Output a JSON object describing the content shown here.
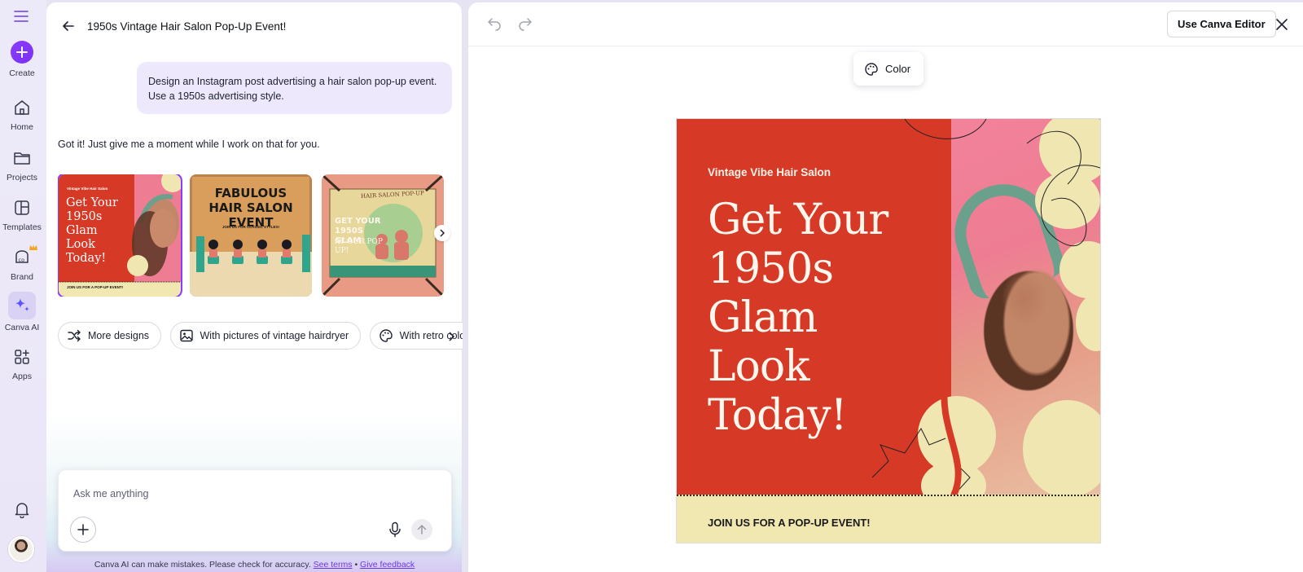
{
  "rail": {
    "items": [
      {
        "label": "Create",
        "icon": "plus-icon"
      },
      {
        "label": "Home",
        "icon": "home-icon"
      },
      {
        "label": "Projects",
        "icon": "folder-icon"
      },
      {
        "label": "Templates",
        "icon": "templates-icon"
      },
      {
        "label": "Brand",
        "icon": "brand-icon"
      },
      {
        "label": "Canva AI",
        "icon": "sparkle-icon"
      },
      {
        "label": "Apps",
        "icon": "apps-icon"
      }
    ]
  },
  "chat": {
    "title": "1950s Vintage Hair Salon Pop-Up Event!",
    "user_message": "Design an Instagram post advertising a hair salon pop-up event. Use a 1950s advertising style.",
    "ai_message": "Got it! Just give me a moment while I work on that for you.",
    "thumbnails": [
      {
        "brand": "Vintage Vibe Hair Salon",
        "headline": "Get Your 1950s Glam Look Today!",
        "cta": "JOIN US FOR A POP-UP EVENT!"
      },
      {
        "headline": "FABULOUS HAIR SALON EVENT",
        "sub": "JOIN US FOR CLASSIC STYLES!"
      },
      {
        "headline": "GET YOUR 1950S GLAM",
        "sub": "AT OUR POP UP!",
        "badge": "HAIR SALON POP-UP"
      }
    ],
    "chips": [
      {
        "label": "More designs",
        "icon": "shuffle-icon"
      },
      {
        "label": "With pictures of vintage hairdryer",
        "icon": "image-icon"
      },
      {
        "label": "With retro colo",
        "icon": "palette-icon"
      }
    ],
    "input_placeholder": "Ask me anything",
    "disclaimer": "Canva AI can make mistakes. Please check for accuracy.",
    "see_terms": "See terms",
    "separator": "•",
    "give_feedback": "Give feedback"
  },
  "preview": {
    "use_editor_label": "Use Canva Editor",
    "color_label": "Color",
    "design": {
      "brand": "Vintage Vibe Hair Salon",
      "headline_lines": [
        "Get Your",
        "1950s",
        "Glam",
        "Look",
        "Today!"
      ],
      "cta": "JOIN US FOR A POP-UP EVENT!",
      "colors": {
        "red": "#d63a27",
        "cream": "#f0e6b2",
        "pink": "#ee7d93",
        "teal": "#6ba08c"
      }
    }
  },
  "colors": {
    "accent": "#8b3dff",
    "bubble": "#ede8fb"
  }
}
